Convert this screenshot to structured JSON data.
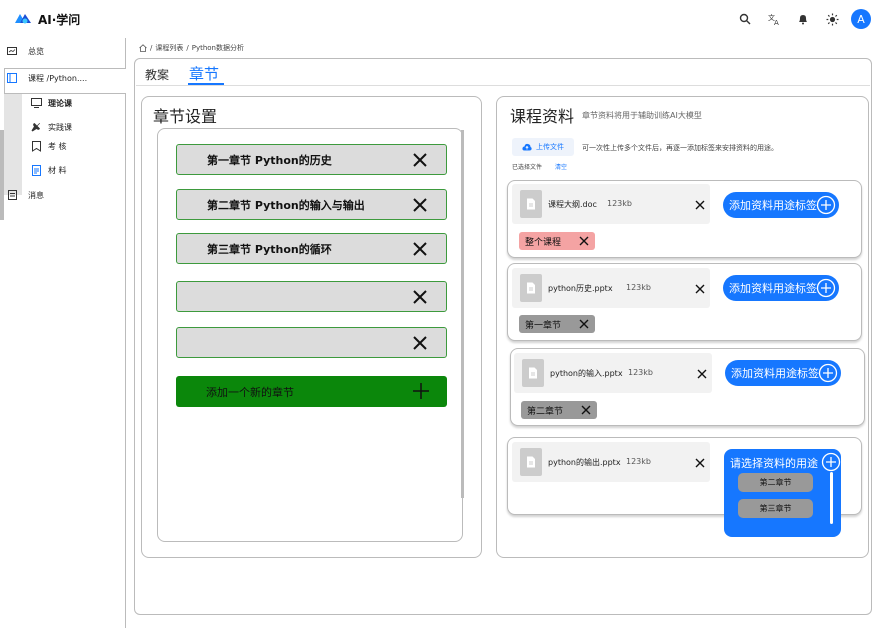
{
  "app": {
    "title": "AI·学问",
    "avatar_initial": "A",
    "accent": "#1677ff"
  },
  "header_icons": [
    "search-icon",
    "translate-icon",
    "bell-icon",
    "sun-icon"
  ],
  "sidebar": {
    "items": [
      {
        "label": "总览",
        "icon": "dashboard-icon"
      },
      {
        "label": "课程 /Python....",
        "icon": "course-icon"
      },
      {
        "label": "消息",
        "icon": "message-icon"
      }
    ],
    "subitems": [
      {
        "label": "理论课",
        "icon": "monitor-icon"
      },
      {
        "label": "实践课",
        "icon": "wrench-icon"
      },
      {
        "label": "考 核",
        "icon": "bookmark-icon"
      },
      {
        "label": "材 料",
        "icon": "document-icon"
      }
    ]
  },
  "breadcrumb": {
    "items": [
      "课程列表",
      "Python数据分析"
    ],
    "separator": "/"
  },
  "tabs": {
    "lesson": "教案",
    "chapter": "章节"
  },
  "chapter_settings": {
    "title": "章节设置",
    "chapters": [
      "第一章节 Python的历史",
      "第二章节 Python的输入与输出",
      "第三章节 Python的循环",
      "",
      ""
    ],
    "add_label": "添加一个新的章节",
    "add_color": "#0b870b"
  },
  "resources": {
    "title": "课程资料",
    "subtitle": "章节资料将用于辅助训练AI大模型",
    "upload_label": "上传文件",
    "upload_hint": "可一次性上传多个文件后，再逐一添加标签来安排资料的用途。",
    "selected_label": "已选择文件",
    "clear_label": "清空",
    "add_tag_label": "添加资料用途标签",
    "files": [
      {
        "name": "课程大纲.doc",
        "size": "123kb",
        "tag": "整个课程",
        "tag_color": "#f4a3a3"
      },
      {
        "name": "python历史.pptx",
        "size": "123kb",
        "tag": "第一章节",
        "tag_color": "#999999"
      },
      {
        "name": "python的输入.pptx",
        "size": "123kb",
        "tag": "第二章节",
        "tag_color": "#999999"
      },
      {
        "name": "python的输出.pptx",
        "size": "123kb",
        "tag": "",
        "tag_color": ""
      }
    ],
    "dropdown": {
      "label": "请选择资料的用途",
      "options": [
        "第二章节",
        "第三章节"
      ]
    }
  }
}
